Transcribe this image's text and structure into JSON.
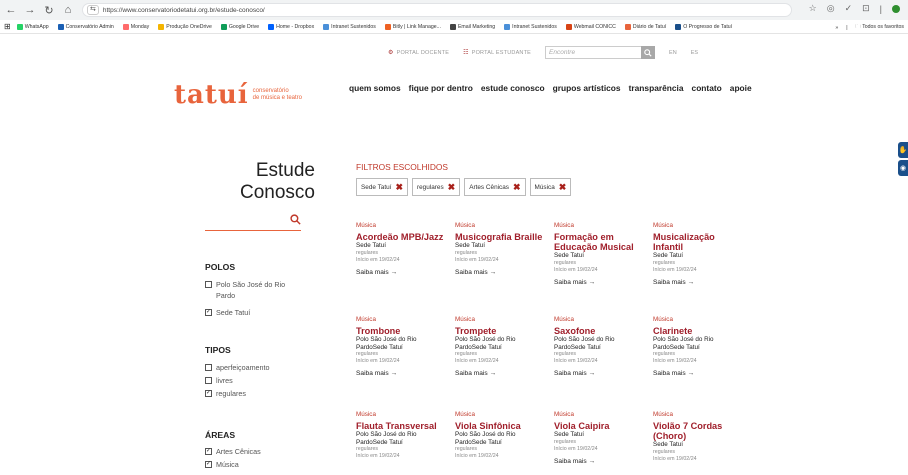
{
  "browser": {
    "url": "https://www.conservatoriodetatui.org.br/estude-conosco/",
    "bookmarks": [
      "WhatsApp",
      "Conservatório Admin",
      "Monday",
      "Produção OneDrive",
      "Google Drive",
      "Home - Dropbox",
      "Intranet Sustenidos",
      "Bitly | Link Manage...",
      "Email Marketing",
      "Intranet Sustenidos",
      "Webmail CONICC",
      "Diário de Tatuí",
      "O Progresso de Tatuí"
    ],
    "bookmarks_overflow": "»",
    "all_bookmarks": "Todos os favoritos"
  },
  "header": {
    "portal_docente": "PORTAL DOCENTE",
    "portal_estudante": "PORTAL ESTUDANTE",
    "search_placeholder": "Encontre",
    "lang_en": "EN",
    "lang_es": "ES",
    "logo_word": "tatuí",
    "logo_sub_1": "conservatório",
    "logo_sub_2": "de música e teatro",
    "nav": [
      "quem somos",
      "fique por dentro",
      "estude conosco",
      "grupos artísticos",
      "transparência",
      "contato",
      "apoie"
    ]
  },
  "sidebar": {
    "title_1": "Estude",
    "title_2": "Conosco",
    "polos": {
      "heading": "POLOS",
      "options": [
        {
          "label": "Polo São José do Rio Pardo",
          "checked": false
        },
        {
          "label": "Sede Tatuí",
          "checked": true
        }
      ]
    },
    "tipos": {
      "heading": "TIPOS",
      "options": [
        {
          "label": "aperfeiçoamento",
          "checked": false
        },
        {
          "label": "livres",
          "checked": false
        },
        {
          "label": "regulares",
          "checked": true
        }
      ]
    },
    "areas": {
      "heading": "ÁREAS",
      "options": [
        {
          "label": "Artes Cênicas",
          "checked": true
        },
        {
          "label": "Música",
          "checked": true
        }
      ]
    }
  },
  "filters": {
    "heading": "FILTROS ESCOLHIDOS",
    "chips": [
      "Sede Tatuí",
      "regulares",
      "Artes Cênicas",
      "Música"
    ]
  },
  "courses": [
    {
      "area": "Música",
      "title": "Acordeão MPB/Jazz",
      "polo": "Sede Tatuí",
      "type": "regulares",
      "date": "Início em 19/02/24",
      "more": "Saiba mais →"
    },
    {
      "area": "Música",
      "title": "Musicografia Braille",
      "polo": "Sede Tatuí",
      "type": "regulares",
      "date": "Início em 19/02/24",
      "more": "Saiba mais →"
    },
    {
      "area": "Música",
      "title": "Formação em Educação Musical",
      "polo": "Sede Tatuí",
      "type": "regulares",
      "date": "Início em 19/02/24",
      "more": "Saiba mais →"
    },
    {
      "area": "Música",
      "title": "Musicalização Infantil",
      "polo": "Sede Tatuí",
      "type": "regulares",
      "date": "Início em 19/02/24",
      "more": "Saiba mais →"
    },
    {
      "area": "Música",
      "title": "Trombone",
      "polo": "Polo São José do Rio PardoSede Tatuí",
      "type": "regulares",
      "date": "Início em 19/02/24",
      "more": "Saiba mais →"
    },
    {
      "area": "Música",
      "title": "Trompete",
      "polo": "Polo São José do Rio PardoSede Tatuí",
      "type": "regulares",
      "date": "Início em 19/02/24",
      "more": "Saiba mais →"
    },
    {
      "area": "Música",
      "title": "Saxofone",
      "polo": "Polo São José do Rio PardoSede Tatuí",
      "type": "regulares",
      "date": "Início em 19/02/24",
      "more": "Saiba mais →"
    },
    {
      "area": "Música",
      "title": "Clarinete",
      "polo": "Polo São José do Rio PardoSede Tatuí",
      "type": "regulares",
      "date": "Início em 19/02/24",
      "more": "Saiba mais →"
    },
    {
      "area": "Música",
      "title": "Flauta Transversal",
      "polo": "Polo São José do Rio PardoSede Tatuí",
      "type": "regulares",
      "date": "Início em 19/02/24",
      "more": ""
    },
    {
      "area": "Música",
      "title": "Viola Sinfônica",
      "polo": "Polo São José do Rio PardoSede Tatuí",
      "type": "regulares",
      "date": "Início em 19/02/24",
      "more": ""
    },
    {
      "area": "Música",
      "title": "Viola Caipira",
      "polo": "Sede Tatuí",
      "type": "regulares",
      "date": "Início em 19/02/24",
      "more": "Saiba mais →"
    },
    {
      "area": "Música",
      "title": "Violão 7 Cordas (Choro)",
      "polo": "Sede Tatuí",
      "type": "regulares",
      "date": "Início em 19/02/24",
      "more": ""
    }
  ],
  "colors": {
    "brand": "#e8643c",
    "course_title": "#a01f2b",
    "accent_red": "#c0392b",
    "side_tab": "#1a4f8a"
  }
}
